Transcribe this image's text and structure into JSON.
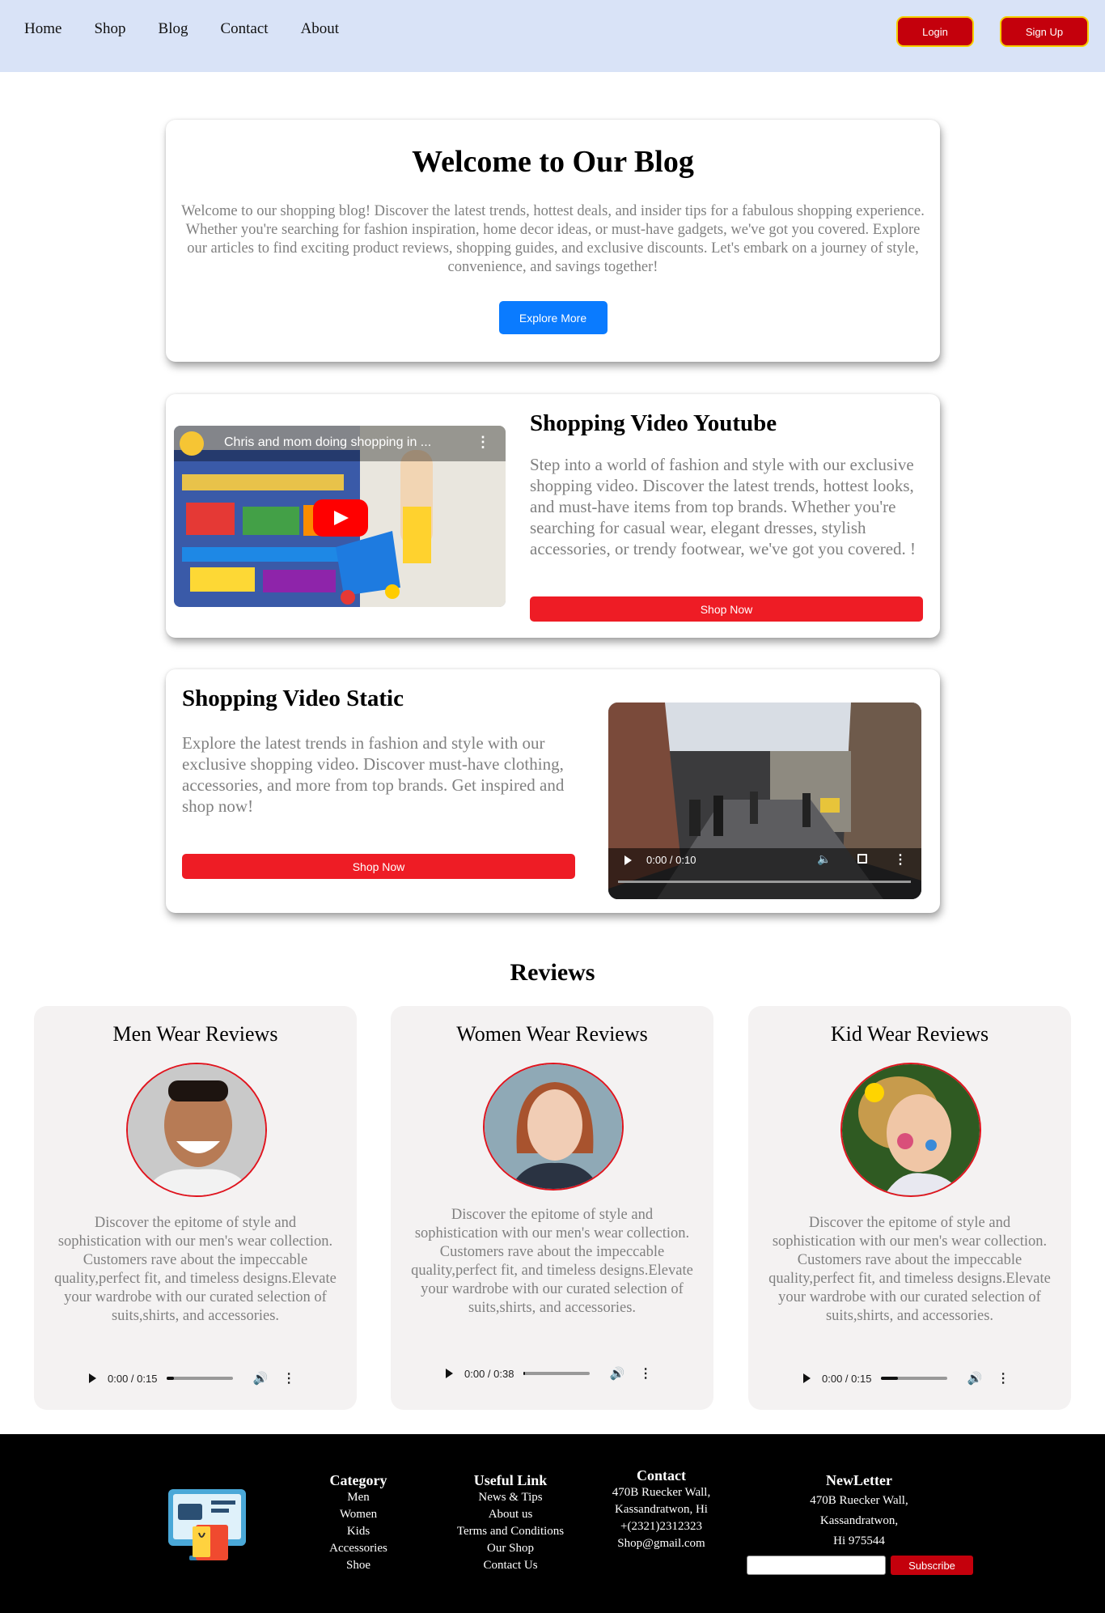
{
  "nav": {
    "links": [
      "Home",
      "Shop",
      "Blog",
      "Contact",
      "About"
    ],
    "login_label": "Login",
    "signup_label": "Sign Up"
  },
  "hero": {
    "title": "Welcome to Our Blog",
    "text": "Welcome to our shopping blog! Discover the latest trends, hottest deals, and insider tips for a fabulous shopping experience. Whether you're searching for fashion inspiration, home decor ideas, or must-have gadgets, we've got you covered. Explore our articles to find exciting product reviews, shopping guides, and exclusive discounts. Let's embark on a journey of style, convenience, and savings together!",
    "button_label": "Explore More"
  },
  "youtube_section": {
    "title": "Shopping Video Youtube",
    "text": "Step into a world of fashion and style with our exclusive shopping video. Discover the latest trends, hottest looks, and must-have items from top brands. Whether you're searching for casual wear, elegant dresses, stylish accessories, or trendy footwear, we've got you covered. !",
    "video_title": "Chris and mom doing shopping in ...",
    "button_label": "Shop Now"
  },
  "static_section": {
    "title": "Shopping Video Static",
    "text": "Explore the latest trends in fashion and style with our exclusive shopping video. Discover must-have clothing, accessories, and more from top brands. Get inspired and shop now!",
    "button_label": "Shop Now",
    "video_time": "0:00 / 0:10"
  },
  "reviews": {
    "title": "Reviews",
    "cards": [
      {
        "title": "Men Wear Reviews",
        "text": "Discover the epitome of style and sophistication with our men's wear collection. Customers rave about the impeccable quality,perfect fit, and timeless designs.Elevate your wardrobe with our curated selection of suits,shirts, and accessories.",
        "audio_time": "0:00 / 0:15",
        "progress": 0.1
      },
      {
        "title": "Women Wear Reviews",
        "text": "Discover the epitome of style and sophistication with our men's wear collection. Customers rave about the impeccable quality,perfect fit, and timeless designs.Elevate your wardrobe with our curated selection of suits,shirts, and accessories.",
        "audio_time": "0:00 / 0:38",
        "progress": 0.02
      },
      {
        "title": "Kid Wear Reviews",
        "text": "Discover the epitome of style and sophistication with our men's wear collection. Customers rave about the impeccable quality,perfect fit, and timeless designs.Elevate your wardrobe with our curated selection of suits,shirts, and accessories.",
        "audio_time": "0:00 / 0:15",
        "progress": 0.25
      }
    ]
  },
  "footer": {
    "category": {
      "title": "Category",
      "items": [
        "Men",
        "Women",
        "Kids",
        "Accessories",
        "Shoe"
      ]
    },
    "useful": {
      "title": "Useful Link",
      "items": [
        "News & Tips",
        "About us",
        "Terms and Conditions",
        "Our Shop",
        "Contact Us"
      ]
    },
    "contact": {
      "title": "Contact",
      "items": [
        "470B Ruecker Wall,",
        "Kassandratwon, Hi",
        "+(2321)2312323",
        "Shop@gmail.com"
      ]
    },
    "newsletter": {
      "title": "NewLetter",
      "items": [
        "470B Ruecker Wall,",
        "Kassandratwon,",
        "Hi 975544"
      ],
      "button_label": "Subscribe"
    }
  }
}
